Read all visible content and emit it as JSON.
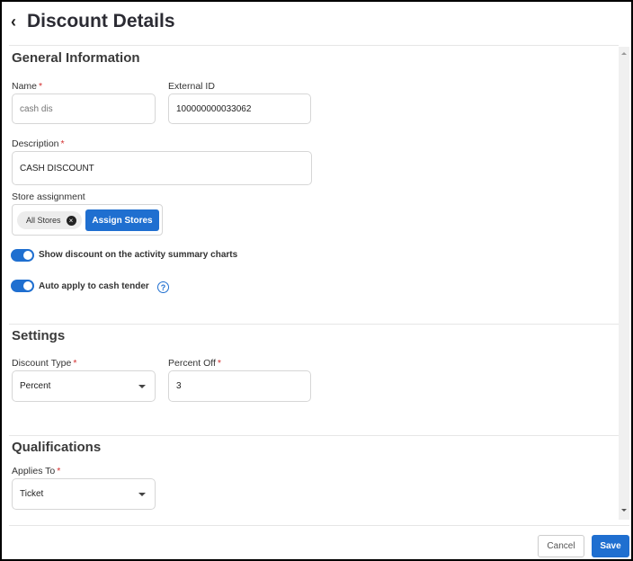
{
  "header": {
    "title": "Discount Details",
    "back_icon": "chevron-left-icon"
  },
  "general": {
    "heading": "General Information",
    "name": {
      "label": "Name",
      "placeholder": "cash dis",
      "value": ""
    },
    "external_id": {
      "label": "External ID",
      "value": "100000000033062"
    },
    "description": {
      "label": "Description",
      "value": "CASH DISCOUNT"
    },
    "store_assignment": {
      "label": "Store assignment",
      "chip": "All Stores",
      "assign_button": "Assign Stores"
    },
    "toggle_show": {
      "label": "Show discount on the activity summary charts",
      "on": true
    },
    "toggle_auto": {
      "label": "Auto apply to cash tender",
      "on": true
    }
  },
  "settings": {
    "heading": "Settings",
    "discount_type": {
      "label": "Discount Type",
      "value": "Percent"
    },
    "percent_off": {
      "label": "Percent Off",
      "value": "3"
    }
  },
  "qualifications": {
    "heading": "Qualifications",
    "applies_to": {
      "label": "Applies To",
      "value": "Ticket"
    }
  },
  "footer": {
    "cancel": "Cancel",
    "save": "Save"
  },
  "required_mark": "*",
  "colors": {
    "accent": "#1f6fd0",
    "required": "#d32f2f"
  }
}
